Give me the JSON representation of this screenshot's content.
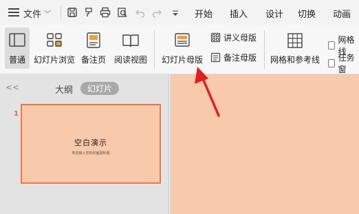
{
  "menubar": {
    "file_label": "文件",
    "tabs": [
      "开始",
      "插入",
      "设计",
      "切换",
      "动画"
    ]
  },
  "ribbon": {
    "view_buttons": [
      "普通",
      "幻灯片浏览",
      "备注页",
      "阅读视图"
    ],
    "master_button": "幻灯片母版",
    "handout_master": "讲义母版",
    "notes_master": "备注母版",
    "grid_guides": "网格和参考线",
    "checkbox_gridlines": "网格线",
    "checkbox_taskpane": "任务窗"
  },
  "leftpanel": {
    "collapse_glyph": "<<",
    "tab_outline": "大纲",
    "tab_slides": "幻灯片",
    "slide_number": "1",
    "thumb_title": "空白演示",
    "thumb_subtitle": "单击输入您的封面副标题"
  },
  "colors": {
    "slide_bg": "#f8c9aa",
    "slide_border": "#e8774a",
    "arrow": "#e02020"
  }
}
